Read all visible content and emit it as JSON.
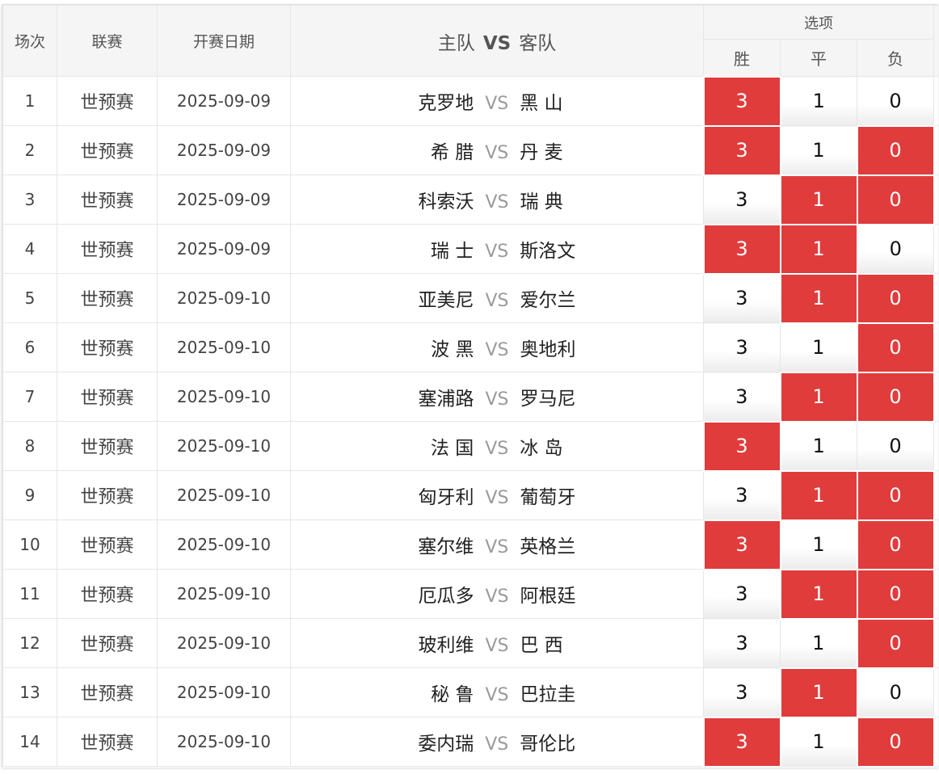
{
  "header": {
    "no": "场次",
    "league": "联赛",
    "date": "开赛日期",
    "home": "主队",
    "vs": "VS",
    "away": "客队",
    "options": "选项",
    "win": "胜",
    "draw": "平",
    "loss": "负"
  },
  "colors": {
    "selected": "#e03c3c",
    "header_bg": "#f5f5f5"
  },
  "matches": [
    {
      "no": "1",
      "league": "世预赛",
      "date": "2025-09-09",
      "home": "克罗地",
      "vs": "VS",
      "away": "黑 山",
      "win": "3",
      "draw": "1",
      "loss": "0",
      "sel": [
        true,
        false,
        false
      ]
    },
    {
      "no": "2",
      "league": "世预赛",
      "date": "2025-09-09",
      "home": "希 腊",
      "vs": "VS",
      "away": "丹 麦",
      "win": "3",
      "draw": "1",
      "loss": "0",
      "sel": [
        true,
        false,
        true
      ]
    },
    {
      "no": "3",
      "league": "世预赛",
      "date": "2025-09-09",
      "home": "科索沃",
      "vs": "VS",
      "away": "瑞 典",
      "win": "3",
      "draw": "1",
      "loss": "0",
      "sel": [
        false,
        true,
        true
      ]
    },
    {
      "no": "4",
      "league": "世预赛",
      "date": "2025-09-09",
      "home": "瑞 士",
      "vs": "VS",
      "away": "斯洛文",
      "win": "3",
      "draw": "1",
      "loss": "0",
      "sel": [
        true,
        true,
        false
      ]
    },
    {
      "no": "5",
      "league": "世预赛",
      "date": "2025-09-10",
      "home": "亚美尼",
      "vs": "VS",
      "away": "爱尔兰",
      "win": "3",
      "draw": "1",
      "loss": "0",
      "sel": [
        false,
        true,
        true
      ]
    },
    {
      "no": "6",
      "league": "世预赛",
      "date": "2025-09-10",
      "home": "波 黑",
      "vs": "VS",
      "away": "奥地利",
      "win": "3",
      "draw": "1",
      "loss": "0",
      "sel": [
        false,
        false,
        true
      ]
    },
    {
      "no": "7",
      "league": "世预赛",
      "date": "2025-09-10",
      "home": "塞浦路",
      "vs": "VS",
      "away": "罗马尼",
      "win": "3",
      "draw": "1",
      "loss": "0",
      "sel": [
        false,
        true,
        true
      ]
    },
    {
      "no": "8",
      "league": "世预赛",
      "date": "2025-09-10",
      "home": "法 国",
      "vs": "VS",
      "away": "冰 岛",
      "win": "3",
      "draw": "1",
      "loss": "0",
      "sel": [
        true,
        false,
        false
      ]
    },
    {
      "no": "9",
      "league": "世预赛",
      "date": "2025-09-10",
      "home": "匈牙利",
      "vs": "VS",
      "away": "葡萄牙",
      "win": "3",
      "draw": "1",
      "loss": "0",
      "sel": [
        false,
        true,
        true
      ]
    },
    {
      "no": "10",
      "league": "世预赛",
      "date": "2025-09-10",
      "home": "塞尔维",
      "vs": "VS",
      "away": "英格兰",
      "win": "3",
      "draw": "1",
      "loss": "0",
      "sel": [
        true,
        false,
        true
      ]
    },
    {
      "no": "11",
      "league": "世预赛",
      "date": "2025-09-10",
      "home": "厄瓜多",
      "vs": "VS",
      "away": "阿根廷",
      "win": "3",
      "draw": "1",
      "loss": "0",
      "sel": [
        false,
        true,
        true
      ]
    },
    {
      "no": "12",
      "league": "世预赛",
      "date": "2025-09-10",
      "home": "玻利维",
      "vs": "VS",
      "away": "巴 西",
      "win": "3",
      "draw": "1",
      "loss": "0",
      "sel": [
        false,
        false,
        true
      ]
    },
    {
      "no": "13",
      "league": "世预赛",
      "date": "2025-09-10",
      "home": "秘 鲁",
      "vs": "VS",
      "away": "巴拉圭",
      "win": "3",
      "draw": "1",
      "loss": "0",
      "sel": [
        false,
        true,
        false
      ]
    },
    {
      "no": "14",
      "league": "世预赛",
      "date": "2025-09-10",
      "home": "委内瑞",
      "vs": "VS",
      "away": "哥伦比",
      "win": "3",
      "draw": "1",
      "loss": "0",
      "sel": [
        true,
        false,
        true
      ]
    }
  ]
}
